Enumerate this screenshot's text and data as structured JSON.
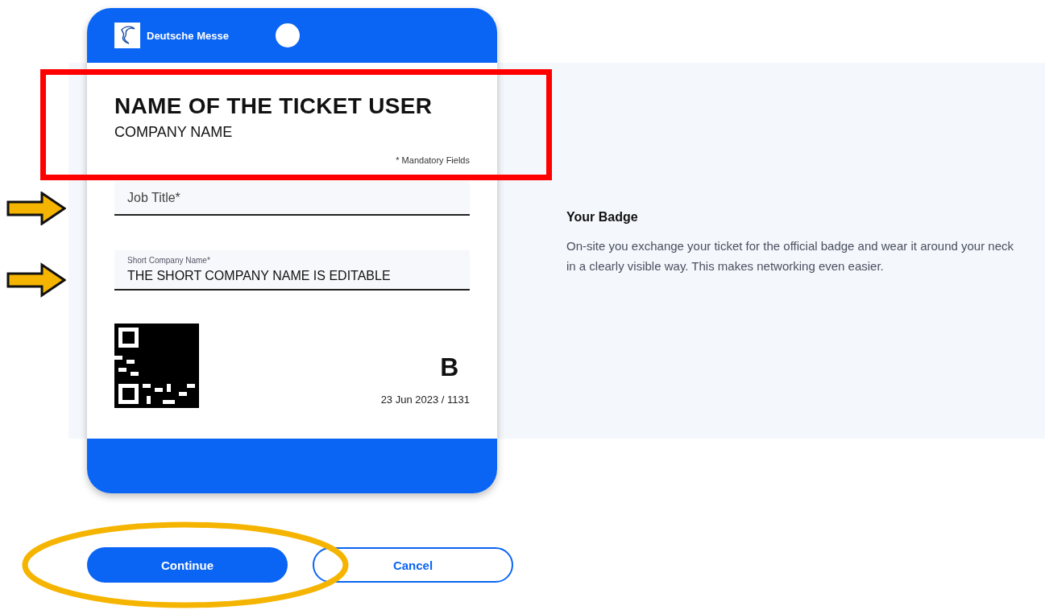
{
  "badge": {
    "organizer": "Deutsche Messe",
    "name": "NAME OF THE TICKET USER",
    "company": "COMPANY NAME",
    "mandatory_note": "* Mandatory Fields",
    "fields": [
      {
        "kind": "empty",
        "placeholder": "Job Title*"
      },
      {
        "kind": "filled",
        "label": "Short Company Name*",
        "value": "THE SHORT COMPANY NAME IS EDITABLE"
      }
    ],
    "category": "B",
    "date_code": "23 Jun 2023 / 1131"
  },
  "info": {
    "title": "Your Badge",
    "text": "On-site you exchange your ticket for the official badge and wear it around your neck in a clearly visible way. This makes networking even easier."
  },
  "buttons": [
    {
      "label": "Continue",
      "kind": "primary"
    },
    {
      "label": "Cancel",
      "kind": "secondary"
    }
  ],
  "annotations": [
    {
      "kind": "rectangle"
    },
    {
      "kind": "arrow"
    },
    {
      "kind": "arrow"
    },
    {
      "kind": "ellipse"
    }
  ]
}
